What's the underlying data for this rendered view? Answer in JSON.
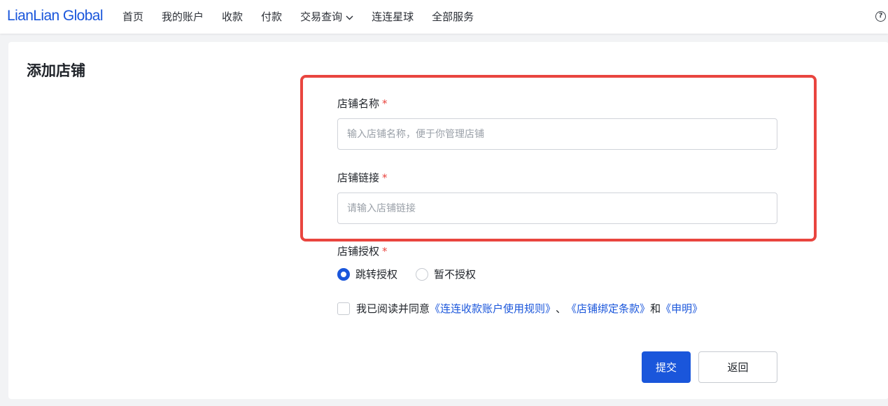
{
  "brand": {
    "logo_text": "LianLian Global"
  },
  "nav": {
    "items": [
      {
        "label": "首页"
      },
      {
        "label": "我的账户"
      },
      {
        "label": "收款"
      },
      {
        "label": "付款"
      },
      {
        "label": "交易查询",
        "has_dropdown": true
      },
      {
        "label": "连连星球"
      },
      {
        "label": "全部服务"
      }
    ],
    "help_icon": "question-circle-icon",
    "help_glyph": "?"
  },
  "page": {
    "title": "添加店铺"
  },
  "form": {
    "required_mark": "*",
    "shop_name": {
      "label": "店铺名称",
      "placeholder": "输入店铺名称，便于你管理店铺",
      "value": ""
    },
    "shop_link": {
      "label": "店铺链接",
      "placeholder": "请输入店铺链接",
      "value": ""
    },
    "auth": {
      "label": "店铺授权",
      "options": [
        {
          "label": "跳转授权",
          "checked": true
        },
        {
          "label": "暂不授权",
          "checked": false
        }
      ]
    },
    "agreement": {
      "checked": false,
      "prefix": "我已阅读并同意",
      "link1": "《连连收款账户使用规则》",
      "sep": "、",
      "link2": "《店铺绑定条款》",
      "and": "和",
      "link3": "《申明》"
    },
    "submit_label": "提交",
    "back_label": "返回"
  },
  "colors": {
    "accent": "#1a56db",
    "highlight": "#e9453f",
    "required": "#e9453f"
  }
}
